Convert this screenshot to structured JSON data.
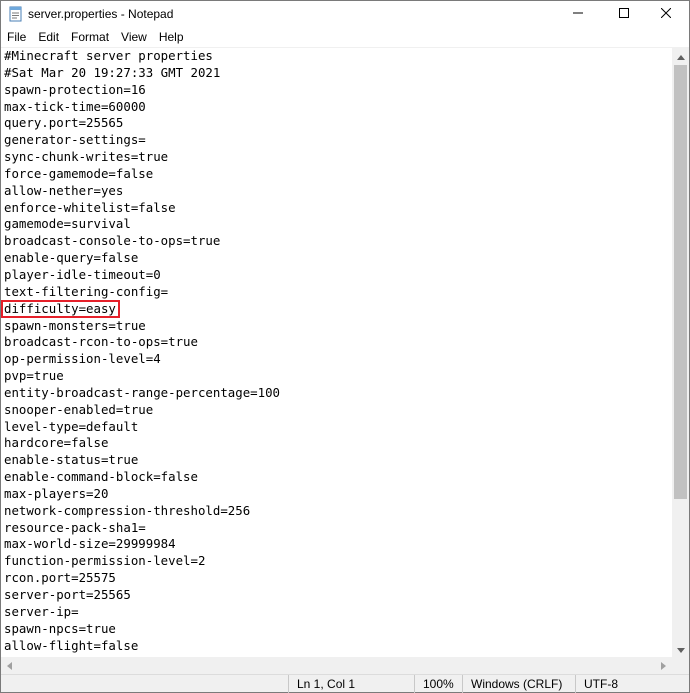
{
  "window": {
    "title": "server.properties - Notepad",
    "icon": "notepad-icon"
  },
  "menu": {
    "items": [
      "File",
      "Edit",
      "Format",
      "View",
      "Help"
    ]
  },
  "editor": {
    "lines": [
      "#Minecraft server properties",
      "#Sat Mar 20 19:27:33 GMT 2021",
      "spawn-protection=16",
      "max-tick-time=60000",
      "query.port=25565",
      "generator-settings=",
      "sync-chunk-writes=true",
      "force-gamemode=false",
      "allow-nether=yes",
      "enforce-whitelist=false",
      "gamemode=survival",
      "broadcast-console-to-ops=true",
      "enable-query=false",
      "player-idle-timeout=0",
      "text-filtering-config=",
      "difficulty=easy",
      "spawn-monsters=true",
      "broadcast-rcon-to-ops=true",
      "op-permission-level=4",
      "pvp=true",
      "entity-broadcast-range-percentage=100",
      "snooper-enabled=true",
      "level-type=default",
      "hardcore=false",
      "enable-status=true",
      "enable-command-block=false",
      "max-players=20",
      "network-compression-threshold=256",
      "resource-pack-sha1=",
      "max-world-size=29999984",
      "function-permission-level=2",
      "rcon.port=25575",
      "server-port=25565",
      "server-ip=",
      "spawn-npcs=true",
      "allow-flight=false"
    ],
    "highlighted_line_index": 15,
    "highlight_color": "#e5202a"
  },
  "status": {
    "position": "Ln 1, Col 1",
    "zoom": "100%",
    "line_ending": "Windows (CRLF)",
    "encoding": "UTF-8"
  }
}
